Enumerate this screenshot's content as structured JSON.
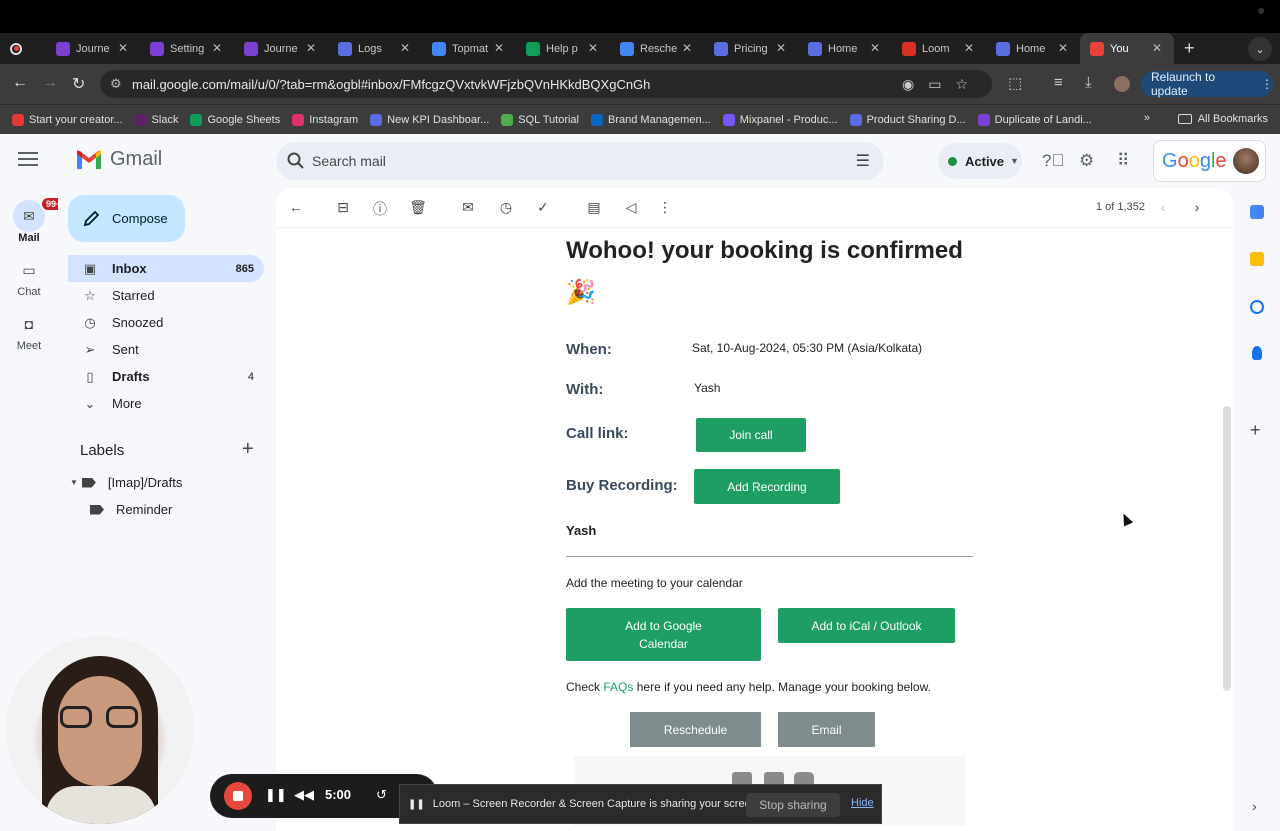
{
  "browser": {
    "tabs": [
      {
        "label": "Journe",
        "color": "#7b3fd1"
      },
      {
        "label": "Setting",
        "color": "#7b3fd1"
      },
      {
        "label": "Journe",
        "color": "#7b3fd1"
      },
      {
        "label": "Logs",
        "color": "#5b6ee1"
      },
      {
        "label": "Topmat",
        "color": "#4285f4"
      },
      {
        "label": "Help p",
        "color": "#0f9d58"
      },
      {
        "label": "Resche",
        "color": "#4285f4"
      },
      {
        "label": "Pricing",
        "color": "#5b6ee1"
      },
      {
        "label": "Home",
        "color": "#5b6ee1"
      },
      {
        "label": "Loom",
        "color": "#d93025"
      },
      {
        "label": "Home",
        "color": "#5b6ee1"
      },
      {
        "label": "You",
        "color": "#ea4335"
      }
    ],
    "url": "mail.google.com/mail/u/0/?tab=rm&ogbl#inbox/FMfcgzQVxtvkWFjzbQVnHKkdBQXgCnGh",
    "relaunch_label": "Relaunch to update",
    "bookmarks": [
      {
        "label": "Start your creator...",
        "color": "#e53935"
      },
      {
        "label": "Slack",
        "color": "#611f69"
      },
      {
        "label": "Google Sheets",
        "color": "#0f9d58"
      },
      {
        "label": "Instagram",
        "color": "#e1306c"
      },
      {
        "label": "New KPI Dashboar...",
        "color": "#5b6ee1"
      },
      {
        "label": "SQL Tutorial",
        "color": "#4caf50"
      },
      {
        "label": "Brand Managemen...",
        "color": "#0a66c2"
      },
      {
        "label": "Mixpanel - Produc...",
        "color": "#7856ff"
      },
      {
        "label": "Product Sharing D...",
        "color": "#5b6ee1"
      },
      {
        "label": "Duplicate of Landi...",
        "color": "#7b3fd1"
      }
    ],
    "all_bookmarks_label": "All Bookmarks"
  },
  "gmail": {
    "logo_text": "Gmail",
    "search_placeholder": "Search mail",
    "status_label": "Active",
    "account_brand": "Google",
    "rail": [
      {
        "label": "Mail",
        "badge": "99+"
      },
      {
        "label": "Chat"
      },
      {
        "label": "Meet"
      }
    ],
    "compose_label": "Compose",
    "nav": [
      {
        "label": "Inbox",
        "count": "865"
      },
      {
        "label": "Starred",
        "count": ""
      },
      {
        "label": "Snoozed",
        "count": ""
      },
      {
        "label": "Sent",
        "count": ""
      },
      {
        "label": "Drafts",
        "count": "4"
      },
      {
        "label": "More",
        "count": ""
      }
    ],
    "labels_heading": "Labels",
    "labels": [
      "[Imap]/Drafts",
      "Reminder"
    ],
    "pager": "1 of 1,352"
  },
  "email": {
    "heading": "Wohoo! your booking is confirmed",
    "emoji": "🎉",
    "when_label": "When:",
    "when_value": "Sat, 10-Aug-2024, 05:30 PM (Asia/Kolkata)",
    "with_label": "With:",
    "with_value": "Yash",
    "call_link_label": "Call link:",
    "join_call": "Join call",
    "buy_recording_label": "Buy Recording:",
    "add_recording": "Add Recording",
    "signature_name": "Yash",
    "calendar_prompt": "Add the meeting to your calendar",
    "add_google_line1": "Add to Google",
    "add_google_line2": "Calendar",
    "add_ical": "Add to iCal / Outlook",
    "check_text": "Check",
    "faqs_link": "FAQs",
    "help_text": "here if you need any help. Manage your booking below.",
    "reschedule": "Reschedule",
    "email_btn": "Email",
    "accent_color": "#1f9e64"
  },
  "loom": {
    "timer": "5:00",
    "share_message": "Loom – Screen Recorder & Screen Capture is sharing your screen.",
    "stop_sharing": "Stop sharing",
    "hide": "Hide"
  }
}
